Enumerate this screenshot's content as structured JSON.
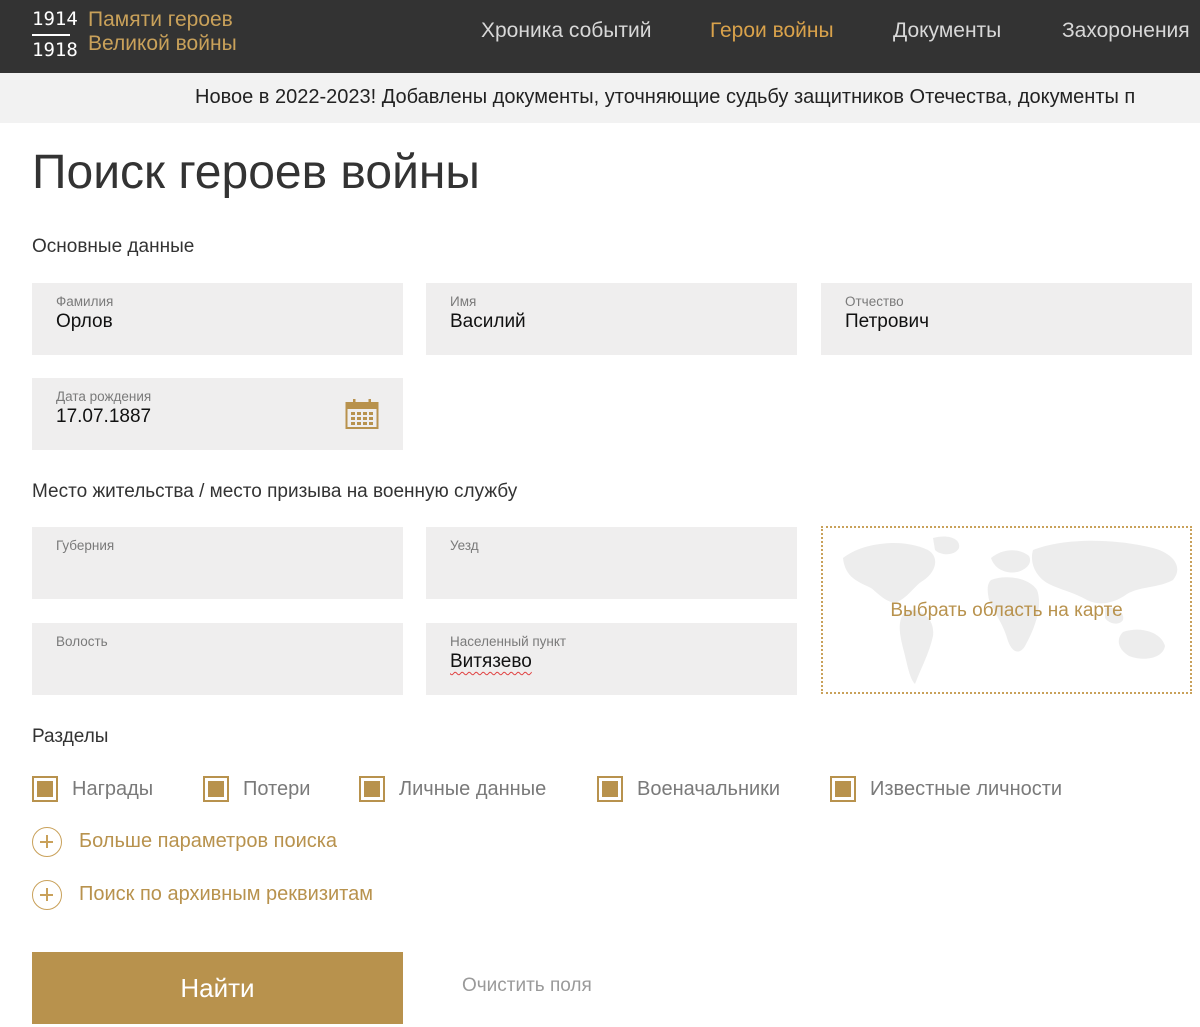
{
  "header": {
    "logo": {
      "year_start": "1914",
      "year_end": "1918",
      "title_line1": "Памяти героев",
      "title_line2": "Великой войны"
    },
    "nav": [
      {
        "label": "Хроника событий",
        "active": false
      },
      {
        "label": "Герои войны",
        "active": true
      },
      {
        "label": "Документы",
        "active": false
      },
      {
        "label": "Захоронения",
        "active": false
      }
    ]
  },
  "ticker": {
    "text": "Новое в 2022-2023! Добавлены документы, уточняющие судьбу защитников Отечества, документы п"
  },
  "page": {
    "title": "Поиск героев войны"
  },
  "basic": {
    "section_label": "Основные данные",
    "last_name": {
      "label": "Фамилия",
      "value": "Орлов"
    },
    "first_name": {
      "label": "Имя",
      "value": "Василий"
    },
    "patronymic": {
      "label": "Отчество",
      "value": "Петрович"
    },
    "birth_date": {
      "label": "Дата рождения",
      "value": "17.07.1887"
    }
  },
  "place": {
    "section_label": "Место жительства / место призыва на военную службу",
    "province": {
      "label": "Губерния",
      "value": ""
    },
    "district": {
      "label": "Уезд",
      "value": ""
    },
    "volost": {
      "label": "Волость",
      "value": ""
    },
    "settlement": {
      "label": "Населенный пункт",
      "value": "Витязево"
    },
    "map_link": "Выбрать область на карте"
  },
  "sections": {
    "label": "Разделы",
    "items": [
      {
        "label": "Награды",
        "checked": true
      },
      {
        "label": "Потери",
        "checked": true
      },
      {
        "label": "Личные данные",
        "checked": true
      },
      {
        "label": "Военачальники",
        "checked": true
      },
      {
        "label": "Известные личности",
        "checked": true
      }
    ]
  },
  "more_params": "Больше параметров поиска",
  "archive_search": "Поиск по архивным реквизитам",
  "buttons": {
    "find": "Найти",
    "clear": "Очистить поля"
  },
  "colors": {
    "accent": "#b8924d",
    "header_bg": "#333333",
    "nav_active": "#d9a24b",
    "field_bg": "#efeeee"
  }
}
